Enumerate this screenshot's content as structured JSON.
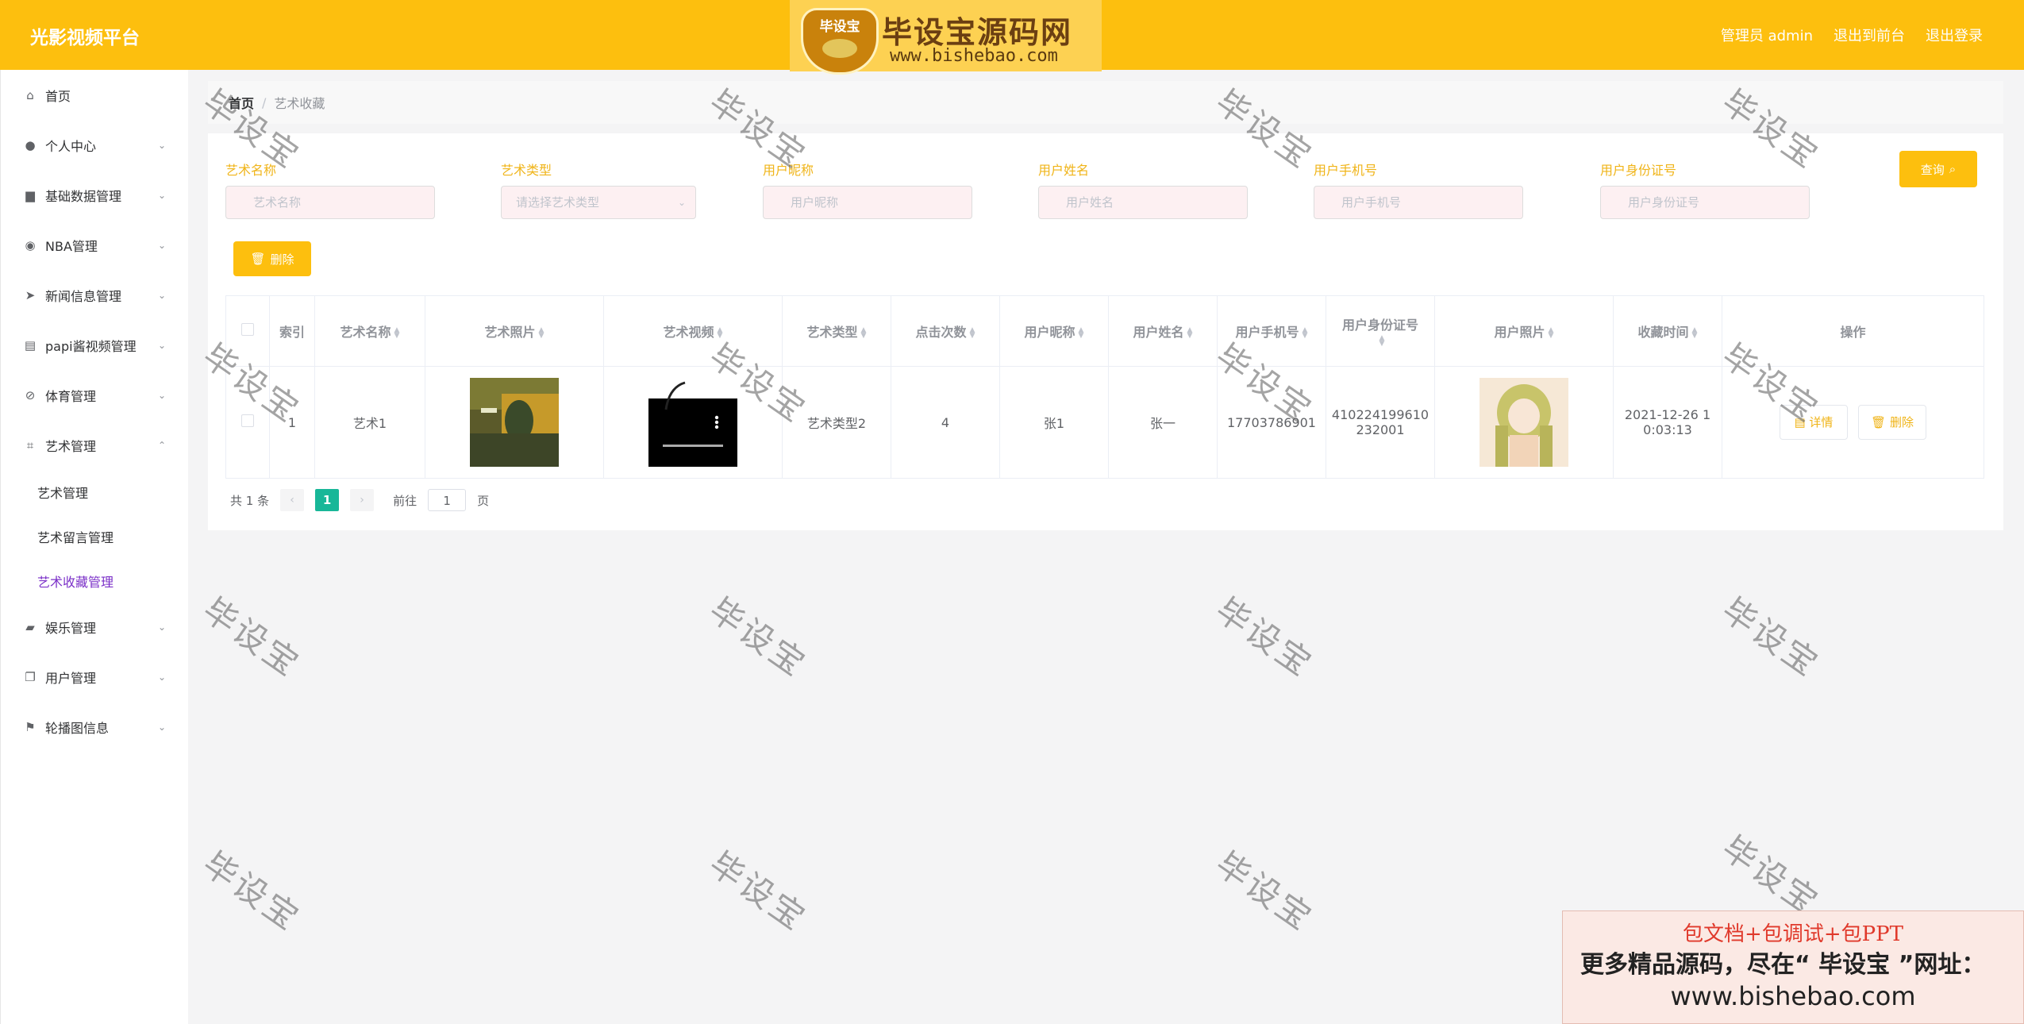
{
  "header": {
    "brand": "光影视频平台",
    "admin_label": "管理员 admin",
    "to_frontend": "退出到前台",
    "logout": "退出登录"
  },
  "banner": {
    "logo_text": "毕设宝",
    "title": "毕设宝源码网",
    "url": "www.bishebao.com"
  },
  "sidebar": {
    "items": [
      {
        "label": "首页",
        "icon": "home-icon"
      },
      {
        "label": "个人中心",
        "icon": "user-icon"
      },
      {
        "label": "基础数据管理",
        "icon": "briefcase-icon"
      },
      {
        "label": "NBA管理",
        "icon": "basketball-icon"
      },
      {
        "label": "新闻信息管理",
        "icon": "send-icon"
      },
      {
        "label": "papi酱视频管理",
        "icon": "clipboard-icon"
      },
      {
        "label": "体育管理",
        "icon": "sport-icon"
      },
      {
        "label": "艺术管理",
        "icon": "crop-icon"
      },
      {
        "label": "娱乐管理",
        "icon": "camera-icon"
      },
      {
        "label": "用户管理",
        "icon": "copy-icon"
      },
      {
        "label": "轮播图信息",
        "icon": "flag-icon"
      }
    ],
    "art_submenu": [
      "艺术管理",
      "艺术留言管理",
      "艺术收藏管理"
    ]
  },
  "breadcrumb": {
    "home": "首页",
    "separator": "/",
    "current": "艺术收藏"
  },
  "search": {
    "fields": [
      {
        "label": "艺术名称",
        "placeholder": "艺术名称"
      },
      {
        "label": "艺术类型",
        "placeholder": "请选择艺术类型"
      },
      {
        "label": "用户昵称",
        "placeholder": "用户昵称"
      },
      {
        "label": "用户姓名",
        "placeholder": "用户姓名"
      },
      {
        "label": "用户手机号",
        "placeholder": "用户手机号"
      },
      {
        "label": "用户身份证号",
        "placeholder": "用户身份证号"
      }
    ],
    "query_button": "查询",
    "delete_button": "删除"
  },
  "table": {
    "headers": [
      "索引",
      "艺术名称",
      "艺术照片",
      "艺术视频",
      "艺术类型",
      "点击次数",
      "用户昵称",
      "用户姓名",
      "用户手机号",
      "用户身份证号",
      "用户照片",
      "收藏时间",
      "操作"
    ],
    "rows": [
      {
        "index": "1",
        "name": "艺术1",
        "type": "艺术类型2",
        "clicks": "4",
        "nickname": "张1",
        "realname": "张一",
        "phone": "17703786901",
        "id_card_1": "410224199610",
        "id_card_2": "232001",
        "time_1": "2021-12-26 1",
        "time_2": "0:03:13",
        "detail_button": "详情",
        "delete_button": "删除"
      }
    ]
  },
  "pagination": {
    "total": "共 1 条",
    "current_page": "1",
    "goto_prefix": "前往",
    "goto_value": "1",
    "goto_suffix": "页"
  },
  "watermark": "毕设宝",
  "ad": {
    "line1": "包文档+包调试+包PPT",
    "line2": "更多精品源码，尽在“ 毕设宝 ”网址：",
    "line3": "www.bishebao.com"
  },
  "colors": {
    "primary": "#fdbf0e",
    "active_menu": "#7b30c8",
    "page_active": "#18b798"
  }
}
